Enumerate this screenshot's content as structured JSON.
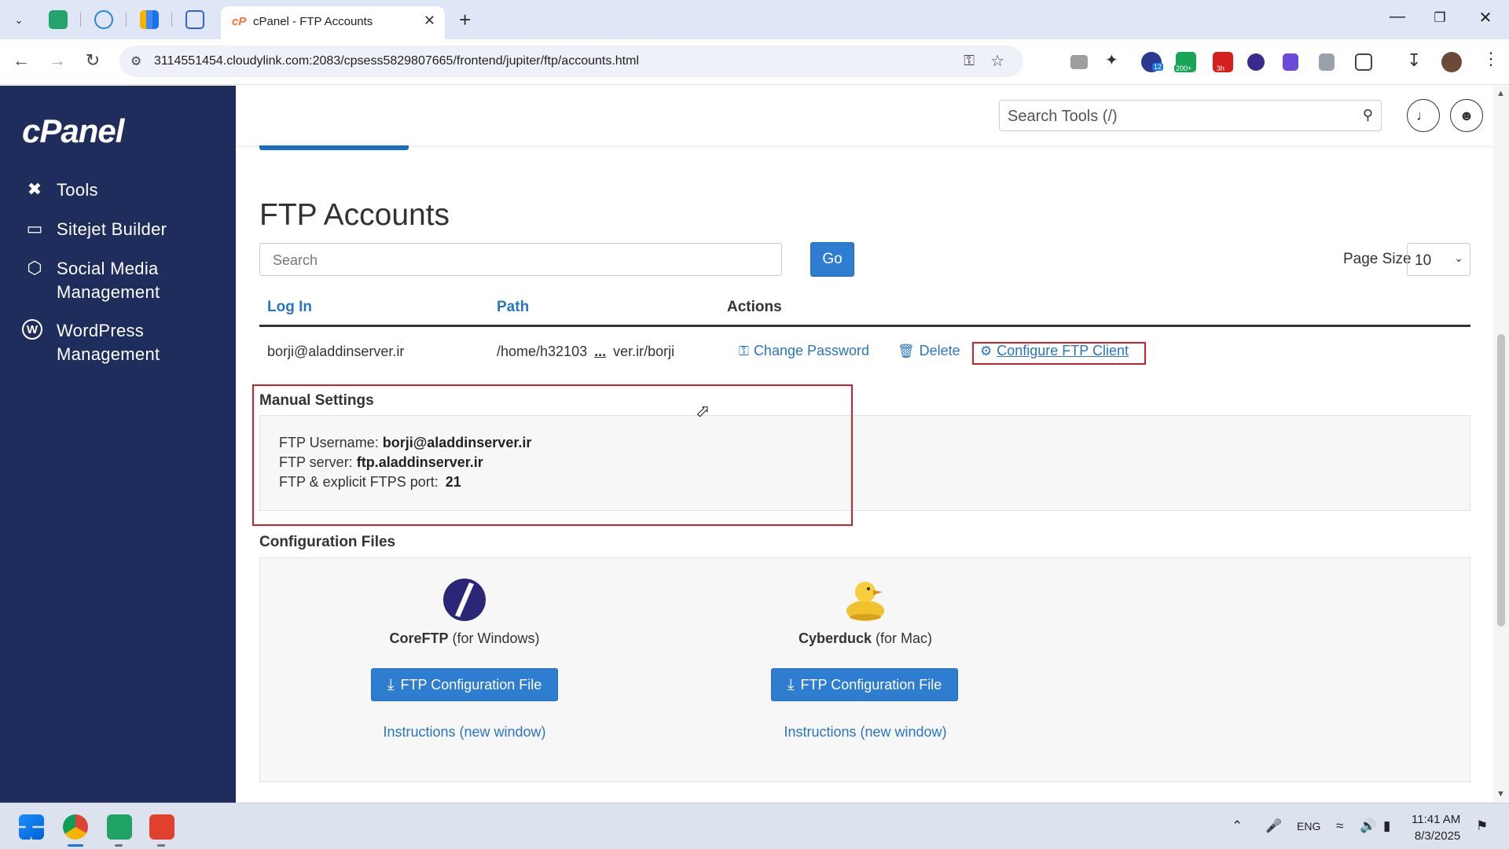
{
  "browser": {
    "tab_title": "cPanel - FTP Accounts",
    "tab_favicon": "cP",
    "url": "3114551454.cloudylink.com:2083/cpsess5829807665/frontend/jupiter/ftp/accounts.html",
    "ext_badges": [
      "12",
      "200+",
      "3h"
    ]
  },
  "sidebar": {
    "logo": "cPanel",
    "items": [
      {
        "label": "Tools",
        "icon": "tools-icon"
      },
      {
        "label": "Sitejet Builder",
        "icon": "monitor-icon"
      },
      {
        "label_line1": "Social Media",
        "label_line2": "Management",
        "icon": "social-icon"
      },
      {
        "label_line1": "WordPress",
        "label_line2": "Management",
        "icon": "wordpress-icon"
      }
    ]
  },
  "topbar": {
    "search_placeholder": "Search Tools (/)"
  },
  "page": {
    "title": "FTP Accounts",
    "search_placeholder": "Search",
    "go_label": "Go",
    "page_size_label": "Page Size",
    "page_size_value": "10"
  },
  "table": {
    "headers": {
      "login": "Log In",
      "path": "Path",
      "actions": "Actions"
    },
    "row": {
      "login": "borji@aladdinserver.ir",
      "path_start": "/home/h32103",
      "path_ellipsis": "...",
      "path_end": "ver.ir/borji",
      "change_password": "Change Password",
      "delete": "Delete",
      "configure": "Configure FTP Client"
    }
  },
  "manual_settings": {
    "title": "Manual Settings",
    "username_label": "FTP Username:",
    "username_value": "borji@aladdinserver.ir",
    "server_label": "FTP server:",
    "server_value": "ftp.aladdinserver.ir",
    "port_label": "FTP & explicit FTPS port:",
    "port_value": "21"
  },
  "config_files": {
    "title": "Configuration Files",
    "clients": [
      {
        "name": "CoreFTP",
        "suffix": " (for Windows)",
        "button": "FTP Configuration File",
        "instructions": "Instructions (new window)"
      },
      {
        "name": "Cyberduck",
        "suffix": " (for Mac)",
        "button": "FTP Configuration File",
        "instructions": "Instructions (new window)"
      }
    ]
  },
  "taskbar": {
    "lang": "ENG",
    "time": "11:41 AM",
    "date": "8/3/2025"
  },
  "colors": {
    "sidebar_bg": "#1f2d5c",
    "link_blue": "#2a75c2",
    "button_blue": "#2f7dd1",
    "highlight_red": "#d0202a"
  }
}
